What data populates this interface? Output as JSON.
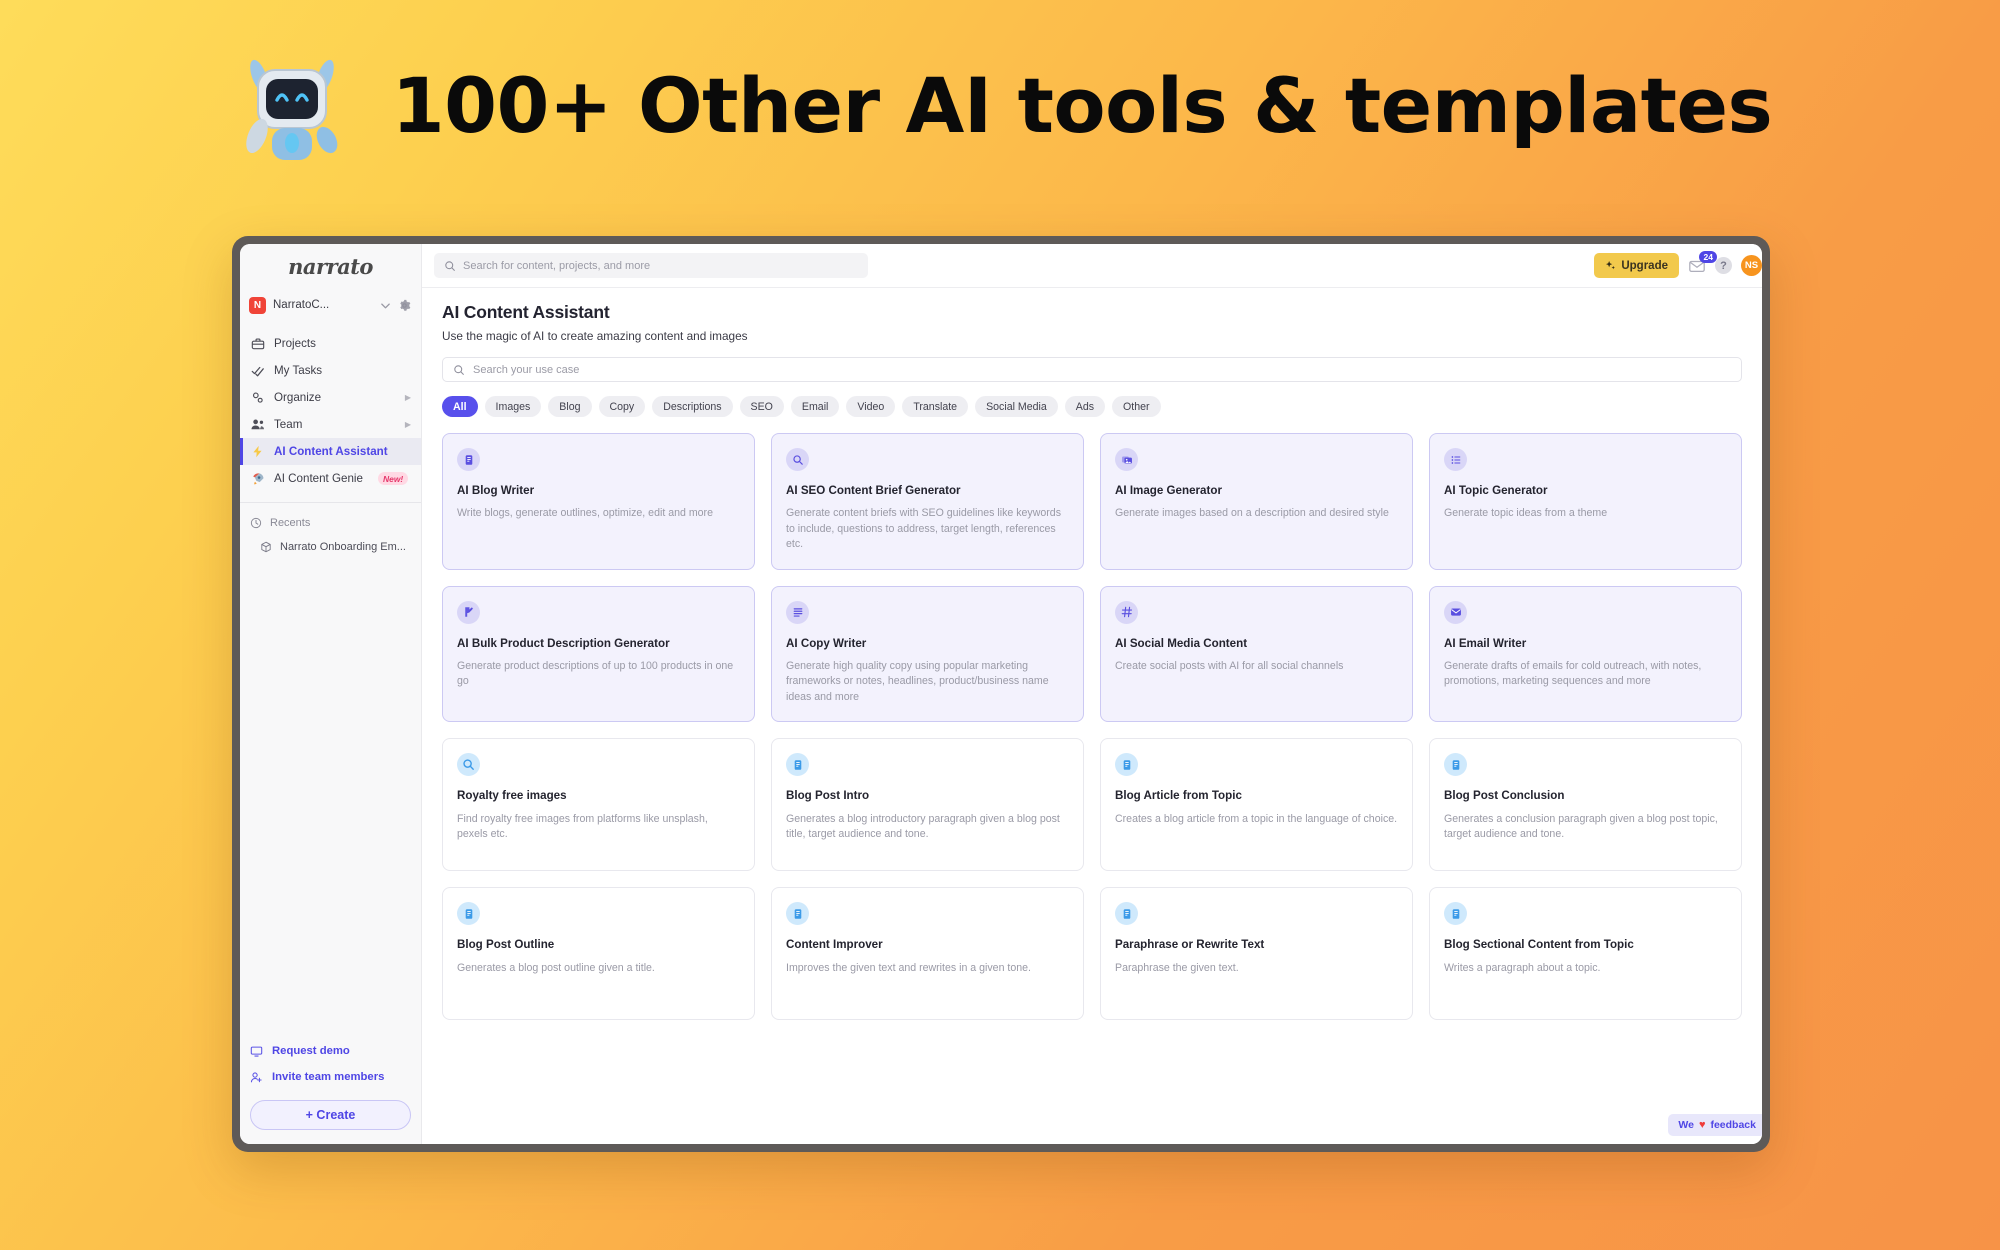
{
  "hero": {
    "title": "100+ Other AI tools & templates",
    "robot_icon": "robot-mascot"
  },
  "sidebar": {
    "brand": "narrato",
    "workspace": {
      "initial": "N",
      "name": "NarratoC...",
      "chevron_icon": "chevron-down-icon",
      "settings_icon": "gear-icon"
    },
    "items": [
      {
        "label": "Projects",
        "icon": "briefcase-icon",
        "active": false,
        "caret": false
      },
      {
        "label": "My Tasks",
        "icon": "check-double-icon",
        "active": false,
        "caret": false
      },
      {
        "label": "Organize",
        "icon": "cogs-icon",
        "active": false,
        "caret": true
      },
      {
        "label": "Team",
        "icon": "people-icon",
        "active": false,
        "caret": true
      },
      {
        "label": "AI Content Assistant",
        "icon": "lightning-icon",
        "active": true,
        "caret": false
      },
      {
        "label": "AI Content Genie",
        "icon": "rocket-icon",
        "active": false,
        "caret": false,
        "badge": "New!"
      }
    ],
    "recents_label": "Recents",
    "recents_icon": "clock-icon",
    "recents": [
      {
        "label": "Narrato Onboarding Em...",
        "icon": "box-icon"
      }
    ],
    "bottom_links": [
      {
        "label": "Request demo",
        "icon": "monitor-icon"
      },
      {
        "label": "Invite team members",
        "icon": "user-plus-icon"
      }
    ],
    "create_button": "+ Create"
  },
  "topbar": {
    "search_placeholder": "Search for content, projects, and more",
    "search_icon": "search-icon",
    "upgrade_label": "Upgrade",
    "upgrade_icon": "sparkle-icon",
    "mail_icon": "envelope-icon",
    "mail_badge": "24",
    "help_icon": "question-mark-icon",
    "help_glyph": "?",
    "avatar_initials": "NS"
  },
  "page": {
    "title": "AI Content Assistant",
    "subtitle": "Use the magic of AI to create amazing content and images",
    "usecase_search_placeholder": "Search your use case",
    "usecase_search_icon": "search-icon"
  },
  "filters": {
    "chips": [
      "All",
      "Images",
      "Blog",
      "Copy",
      "Descriptions",
      "SEO",
      "Email",
      "Video",
      "Translate",
      "Social Media",
      "Ads",
      "Other"
    ],
    "active": "All"
  },
  "cards": [
    {
      "title": "AI Blog Writer",
      "desc": "Write blogs, generate outlines, optimize, edit and more",
      "icon": "document-lines-icon",
      "style": "purple",
      "icon_style": "v-purple"
    },
    {
      "title": "AI SEO Content Brief Generator",
      "desc": "Generate content briefs with SEO guidelines like keywords to include, questions to address, target length, references etc.",
      "icon": "magnifier-doc-icon",
      "style": "purple",
      "icon_style": "v-purple"
    },
    {
      "title": "AI Image Generator",
      "desc": "Generate images based on a description and desired style",
      "icon": "image-stack-icon",
      "style": "purple",
      "icon_style": "v-purple"
    },
    {
      "title": "AI Topic Generator",
      "desc": "Generate topic ideas from a theme",
      "icon": "list-icon",
      "style": "purple",
      "icon_style": "v-purple"
    },
    {
      "title": "AI Bulk Product Description Generator",
      "desc": "Generate product descriptions of up to 100 products in one go",
      "icon": "pencil-doc-icon",
      "style": "purple",
      "icon_style": "v-purple"
    },
    {
      "title": "AI Copy Writer",
      "desc": "Generate high quality copy using popular marketing frameworks or notes, headlines, product/business name ideas and more",
      "icon": "text-lines-icon",
      "style": "purple",
      "icon_style": "v-purple"
    },
    {
      "title": "AI Social Media Content",
      "desc": "Create social posts with AI for all social channels",
      "icon": "hashtag-icon",
      "style": "purple",
      "icon_style": "v-purple"
    },
    {
      "title": "AI Email Writer",
      "desc": "Generate drafts of emails for cold outreach, with notes, promotions, marketing sequences and more",
      "icon": "envelope-icon",
      "style": "purple",
      "icon_style": "v-purple"
    },
    {
      "title": "Royalty free images",
      "desc": "Find royalty free images from platforms like unsplash, pexels etc.",
      "icon": "search-icon",
      "style": "plain",
      "icon_style": "v-blue"
    },
    {
      "title": "Blog Post Intro",
      "desc": "Generates a blog introductory paragraph given a blog post title, target audience and tone.",
      "icon": "document-lines-icon",
      "style": "plain",
      "icon_style": "v-blue"
    },
    {
      "title": "Blog Article from Topic",
      "desc": "Creates a blog article from a topic in the language of choice.",
      "icon": "document-lines-icon",
      "style": "plain",
      "icon_style": "v-blue"
    },
    {
      "title": "Blog Post Conclusion",
      "desc": "Generates a conclusion paragraph given a blog post topic, target audience and tone.",
      "icon": "document-lines-icon",
      "style": "plain",
      "icon_style": "v-blue"
    },
    {
      "title": "Blog Post Outline",
      "desc": "Generates a blog post outline given a title.",
      "icon": "document-lines-icon",
      "style": "plain",
      "icon_style": "v-blue"
    },
    {
      "title": "Content Improver",
      "desc": "Improves the given text and rewrites in a given tone.",
      "icon": "document-lines-icon",
      "style": "plain",
      "icon_style": "v-blue"
    },
    {
      "title": "Paraphrase or Rewrite Text",
      "desc": "Paraphrase the given text.",
      "icon": "document-lines-icon",
      "style": "plain",
      "icon_style": "v-blue"
    },
    {
      "title": "Blog Sectional Content from Topic",
      "desc": "Writes a paragraph about a topic.",
      "icon": "document-lines-icon",
      "style": "plain",
      "icon_style": "v-blue"
    }
  ],
  "feedback": {
    "prefix": "We",
    "heart": "♥",
    "suffix": "feedback"
  },
  "colors": {
    "accent": "#4f46e5",
    "chip_active": "#5850ec",
    "upgrade": "#f2c94c",
    "avatar": "#f7941e",
    "badge_red": "#f04438",
    "new_badge": "#e5396c",
    "icon_blue": "#3b9ae8"
  }
}
